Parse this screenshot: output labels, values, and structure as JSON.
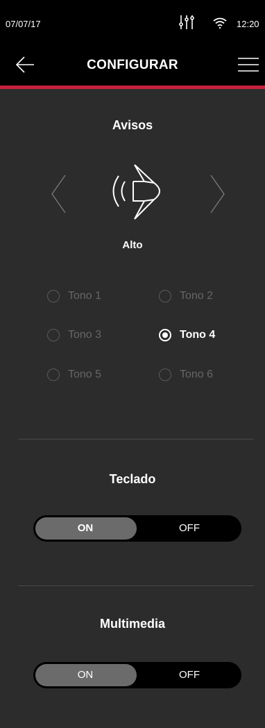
{
  "status_bar": {
    "date": "07/07/17",
    "time": "12:20"
  },
  "header": {
    "title": "CONFIGURAR"
  },
  "alerts": {
    "title": "Avisos",
    "level": "Alto",
    "tones": [
      "Tono 1",
      "Tono 2",
      "Tono 3",
      "Tono 4",
      "Tono 5",
      "Tono 6"
    ],
    "selected_tone": "Tono 4"
  },
  "keyboard": {
    "title": "Teclado",
    "on_label": "ON",
    "off_label": "OFF",
    "state": "ON"
  },
  "multimedia": {
    "title": "Multimedia",
    "on_label": "ON",
    "off_label": "OFF",
    "state": "ON"
  },
  "colors": {
    "accent": "#c8213b",
    "background": "#2c2c2c",
    "bar": "#000000"
  }
}
